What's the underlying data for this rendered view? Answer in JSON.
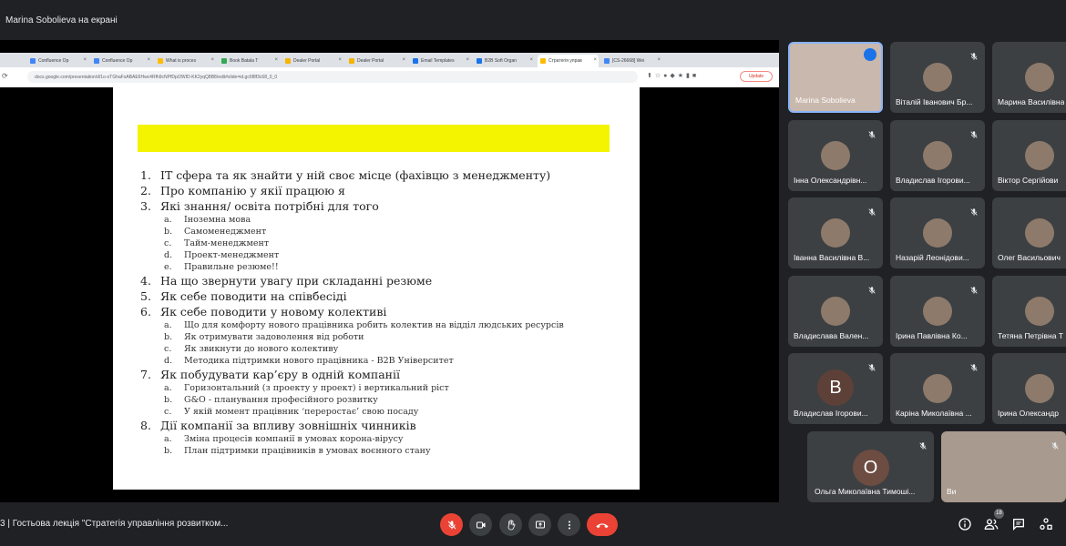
{
  "presenter_banner": "Marina Sobolieva на екрані",
  "browser": {
    "tabs": [
      {
        "label": "Confluence Op",
        "color": "#4285f4"
      },
      {
        "label": "Confluence Op",
        "color": "#4285f4"
      },
      {
        "label": "What is proces",
        "color": "#fbbc04"
      },
      {
        "label": "Book Batala T",
        "color": "#34a853"
      },
      {
        "label": "Dealer Portal",
        "color": "#f4b400"
      },
      {
        "label": "Dealer Portal",
        "color": "#f4b400"
      },
      {
        "label": "Email Templates",
        "color": "#1a73e8"
      },
      {
        "label": "B2B Soft Organ",
        "color": "#1a73e8"
      },
      {
        "label": "Стратегія управ",
        "color": "#fbbc04"
      },
      {
        "label": "[CS-26668] Wei",
        "color": "#4285f4"
      }
    ],
    "url": "docs.google.com/presentation/d/1o-oTGhaFsABAE6Hwc4Rfh9cNPfDp/2WID-KK2yqQ8B8/edit#slide=id.gc6f8f3c68_0_0",
    "update_label": "Update"
  },
  "slide": {
    "items": [
      {
        "num": "1.",
        "text": "IT сфера та як знайти у ній своє місце (фахівцю з менеджменту)",
        "subs": []
      },
      {
        "num": "2.",
        "text": "Про компанію у якії працюю я",
        "subs": []
      },
      {
        "num": "3.",
        "text": "Які знання/ освіта  потрібні для того",
        "subs": [
          {
            "num": "a.",
            "text": "Іноземна мова"
          },
          {
            "num": "b.",
            "text": "Самоменеджмент"
          },
          {
            "num": "c.",
            "text": "Тайм-менеджмент"
          },
          {
            "num": "d.",
            "text": "Проект-менеджмент"
          },
          {
            "num": "e.",
            "text": "Правильне резюме!!"
          }
        ]
      },
      {
        "num": "4.",
        "text": "На що звернути увагу при складанні резюме",
        "subs": []
      },
      {
        "num": "5.",
        "text": "Як себе поводити на співбесіді",
        "subs": []
      },
      {
        "num": "6.",
        "text": "Як себе поводити у новому колективі",
        "subs": [
          {
            "num": "a.",
            "text": "Що для комфорту нового працівника робить колектив на відділ людських ресурсів"
          },
          {
            "num": "b.",
            "text": "Як отримувати задоволення від роботи"
          },
          {
            "num": "c.",
            "text": "Як звикнути до нового колективу"
          },
          {
            "num": "d.",
            "text": "Методика підтримки нового працівника - B2B Університет"
          }
        ]
      },
      {
        "num": "7.",
        "text": "Як побудувати кар’єру в одній компанії",
        "subs": [
          {
            "num": "a.",
            "text": "Горизонтальний (з проекту у проект) і вертикальний ріст"
          },
          {
            "num": "b.",
            "text": "G&O - планування професійного розвитку"
          },
          {
            "num": "c.",
            "text": "У якій момент працівник ‘переростає’ свою посаду"
          }
        ]
      },
      {
        "num": "8.",
        "text": "Дії компанії за впливу зовнішніх чинників",
        "subs": [
          {
            "num": "a.",
            "text": "Зміна процесів компанії в умовах корона-вірусу"
          },
          {
            "num": "b.",
            "text": "План підтримки працівників в умовах воєнного стану"
          }
        ]
      }
    ]
  },
  "participants": [
    {
      "name": "Marina Sobolieva",
      "speaking": true
    },
    {
      "name": "Віталій Іванович Бр..."
    },
    {
      "name": "Марина Василівна"
    },
    {
      "name": "Інна Олександрівн..."
    },
    {
      "name": "Владислав Ігорови..."
    },
    {
      "name": "Віктор Сергійови"
    },
    {
      "name": "Іванна Василівна В..."
    },
    {
      "name": "Назарій Леонідови..."
    },
    {
      "name": "Олег Васильович"
    },
    {
      "name": "Владислава Вален..."
    },
    {
      "name": "Ірина Павлівна Ко..."
    },
    {
      "name": "Тетяна Петрівна Т"
    },
    {
      "name": "Владислав Ігорови...",
      "letter": "В",
      "color": "#5d4037"
    },
    {
      "name": "Каріна Миколаївна ..."
    },
    {
      "name": "Ірина Олександр"
    },
    {
      "name": "Ольга Миколаївна Тимоші...",
      "letter": "О",
      "color": "#6d4c41"
    },
    {
      "name": "Ви"
    }
  ],
  "bottom": {
    "meeting_title": "3  |  Гостьова лекція \"Стратегія управління розвитком...",
    "people_count": "18"
  }
}
